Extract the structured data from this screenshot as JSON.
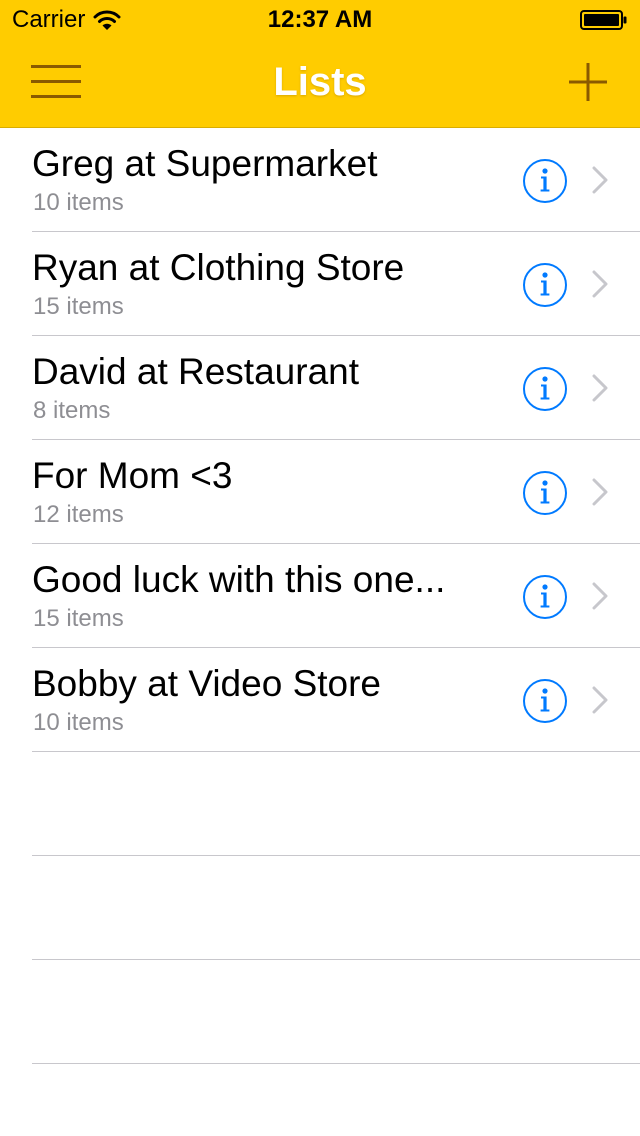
{
  "status_bar": {
    "carrier": "Carrier",
    "time": "12:37 AM",
    "icons": [
      "wifi-icon",
      "battery-icon"
    ]
  },
  "nav": {
    "title": "Lists",
    "left_icon": "hamburger-menu-icon",
    "right_icon": "plus-icon"
  },
  "colors": {
    "bar_background": "#ffcc00",
    "bar_icon": "#8a5a00",
    "accent": "#007aff",
    "subtitle": "#8e8e93",
    "separator": "#c8c7cc"
  },
  "lists": [
    {
      "title": "Greg at Supermarket",
      "subtitle": "10 items"
    },
    {
      "title": "Ryan at Clothing Store",
      "subtitle": "15 items"
    },
    {
      "title": "David at Restaurant",
      "subtitle": "8 items"
    },
    {
      "title": "For Mom <3",
      "subtitle": "12 items"
    },
    {
      "title": "Good luck with this one...",
      "subtitle": "15 items"
    },
    {
      "title": "Bobby at Video Store",
      "subtitle": "10 items"
    }
  ],
  "row_icons": [
    "info-circle-icon",
    "chevron-right-icon"
  ]
}
